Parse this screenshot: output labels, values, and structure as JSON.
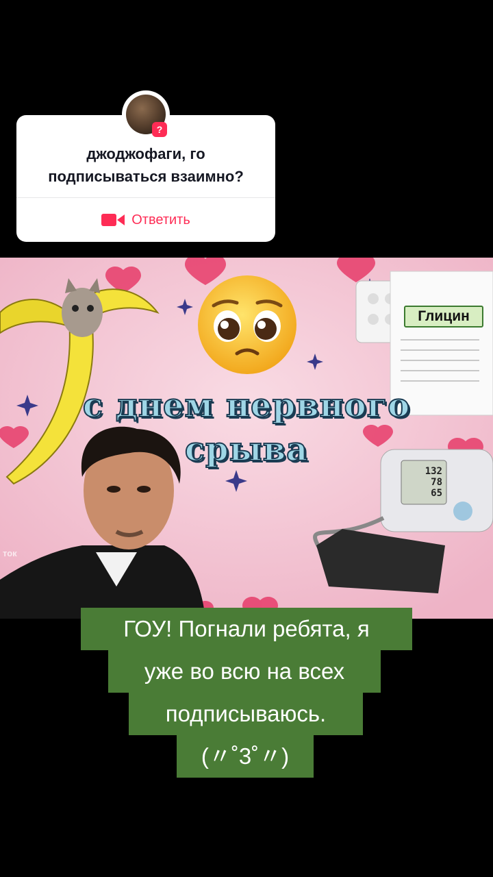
{
  "question_card": {
    "text": "джоджофаги, го\nподписываться взаимно?",
    "badge": "?",
    "reply_label": "Ответить",
    "accent": "#fe2c55"
  },
  "meme": {
    "title": "с днем нервного\nсрыва",
    "glycine_label": "Глицин",
    "bp_values": [
      "132",
      "78",
      "65"
    ],
    "watermark": "ток",
    "background": "#f4c7d4"
  },
  "caption": {
    "lines": [
      "ГОУ! Погнали ребята, я",
      "уже во всю на всех",
      "подписываюсь.",
      "(〃˚3˚〃)"
    ],
    "background": "#4a7c36"
  }
}
